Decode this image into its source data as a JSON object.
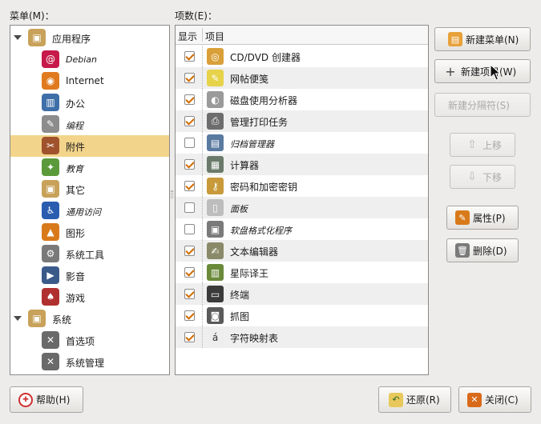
{
  "menus_label": "菜单(M)：",
  "items_label": "项数(E)：",
  "tree": [
    {
      "label": "应用程序",
      "italic": false,
      "expander": true,
      "level": 0,
      "icon": "applications-icon",
      "color": "#c8a25a"
    },
    {
      "label": "Debian",
      "italic": true,
      "level": 1,
      "icon": "debian-icon",
      "color": "#c51a4a"
    },
    {
      "label": "Internet",
      "italic": false,
      "level": 1,
      "icon": "internet-icon",
      "color": "#e07a1f"
    },
    {
      "label": "办公",
      "italic": false,
      "level": 1,
      "icon": "office-icon",
      "color": "#3f6fa8"
    },
    {
      "label": "编程",
      "italic": true,
      "level": 1,
      "icon": "programming-icon",
      "color": "#8c8c8c"
    },
    {
      "label": "附件",
      "italic": false,
      "level": 1,
      "icon": "accessories-icon",
      "color": "#a0522d",
      "selected": true
    },
    {
      "label": "教育",
      "italic": true,
      "level": 1,
      "icon": "education-icon",
      "color": "#5a9a3a"
    },
    {
      "label": "其它",
      "italic": false,
      "level": 1,
      "icon": "other-icon",
      "color": "#c8a25a"
    },
    {
      "label": "通用访问",
      "italic": true,
      "level": 1,
      "icon": "accessibility-icon",
      "color": "#2a5db0"
    },
    {
      "label": "图形",
      "italic": false,
      "level": 1,
      "icon": "graphics-icon",
      "color": "#d87a1a"
    },
    {
      "label": "系统工具",
      "italic": false,
      "level": 1,
      "icon": "system-tools-icon",
      "color": "#7a7a7a"
    },
    {
      "label": "影音",
      "italic": false,
      "level": 1,
      "icon": "multimedia-icon",
      "color": "#3a5a8a"
    },
    {
      "label": "游戏",
      "italic": false,
      "level": 1,
      "icon": "games-icon",
      "color": "#b03030"
    },
    {
      "label": "系统",
      "italic": false,
      "expander": true,
      "level": 0,
      "icon": "system-icon",
      "color": "#c8a25a"
    },
    {
      "label": "首选项",
      "italic": false,
      "level": 1,
      "icon": "preferences-icon",
      "color": "#6a6a6a"
    },
    {
      "label": "系统管理",
      "italic": false,
      "level": 1,
      "icon": "administration-icon",
      "color": "#6a6a6a"
    }
  ],
  "items_header": {
    "show": "显示",
    "item": "项目"
  },
  "items": [
    {
      "label": "CD/DVD 创建器",
      "checked": true,
      "italic": false,
      "icon": "cd-burner-icon",
      "color": "#d9a03a"
    },
    {
      "label": "网帖便笺",
      "checked": true,
      "italic": false,
      "icon": "sticky-notes-icon",
      "color": "#e6d34a"
    },
    {
      "label": "磁盘使用分析器",
      "checked": true,
      "italic": false,
      "icon": "disk-analyzer-icon",
      "color": "#9a9a9a"
    },
    {
      "label": "管理打印任务",
      "checked": true,
      "italic": false,
      "icon": "printer-icon",
      "color": "#6d6d6d"
    },
    {
      "label": "归档管理器",
      "checked": false,
      "italic": true,
      "icon": "archive-manager-icon",
      "color": "#5a7aa0"
    },
    {
      "label": "计算器",
      "checked": true,
      "italic": false,
      "icon": "calculator-icon",
      "color": "#6a7a6a"
    },
    {
      "label": "密码和加密密钥",
      "checked": true,
      "italic": false,
      "icon": "keys-icon",
      "color": "#c89a3a"
    },
    {
      "label": "面板",
      "checked": false,
      "italic": true,
      "icon": "panel-icon",
      "color": "#bdbdbd"
    },
    {
      "label": "软盘格式化程序",
      "checked": false,
      "italic": true,
      "icon": "floppy-icon",
      "color": "#7a7a7a"
    },
    {
      "label": "文本编辑器",
      "checked": true,
      "italic": false,
      "icon": "text-editor-icon",
      "color": "#8a8a6a"
    },
    {
      "label": "星际译王",
      "checked": true,
      "italic": false,
      "icon": "dictionary-icon",
      "color": "#6a8a3a"
    },
    {
      "label": "终端",
      "checked": true,
      "italic": false,
      "icon": "terminal-icon",
      "color": "#3a3a3a"
    },
    {
      "label": "抓图",
      "checked": true,
      "italic": false,
      "icon": "screenshot-icon",
      "color": "#5a5a5a"
    },
    {
      "label": "字符映射表",
      "checked": true,
      "italic": false,
      "icon": "character-map-icon",
      "color": "#eeeeee"
    }
  ],
  "buttons": {
    "new_menu": "新建菜单(N)",
    "new_item": "新建项目(W)",
    "new_separator": "新建分隔符(S)",
    "move_up": "上移",
    "move_down": "下移",
    "properties": "属性(P)",
    "delete": "删除(D)",
    "help": "帮助(H)",
    "revert": "还原(R)",
    "close": "关闭(C)"
  }
}
